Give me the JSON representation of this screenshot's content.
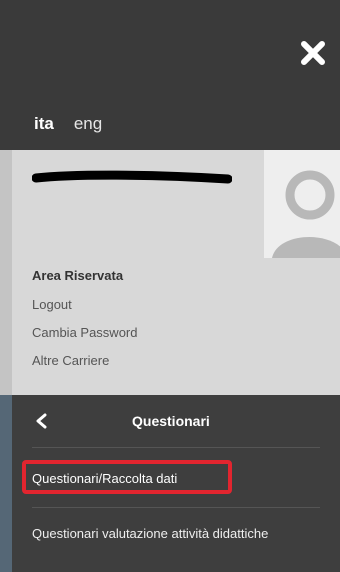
{
  "header": {
    "close_icon": "close-icon"
  },
  "language": {
    "active": "ita",
    "other": "eng"
  },
  "user_panel": {
    "area_title": "Area Riservata",
    "links": [
      "Logout",
      "Cambia Password",
      "Altre Carriere"
    ]
  },
  "submenu": {
    "title": "Questionari",
    "items": [
      "Questionari/Raccolta dati",
      "Questionari valutazione attività didattiche"
    ]
  },
  "colors": {
    "highlight_border": "#e2252f",
    "menu_bg": "#3e3e3e",
    "panel_bg": "#d8d8d8"
  }
}
